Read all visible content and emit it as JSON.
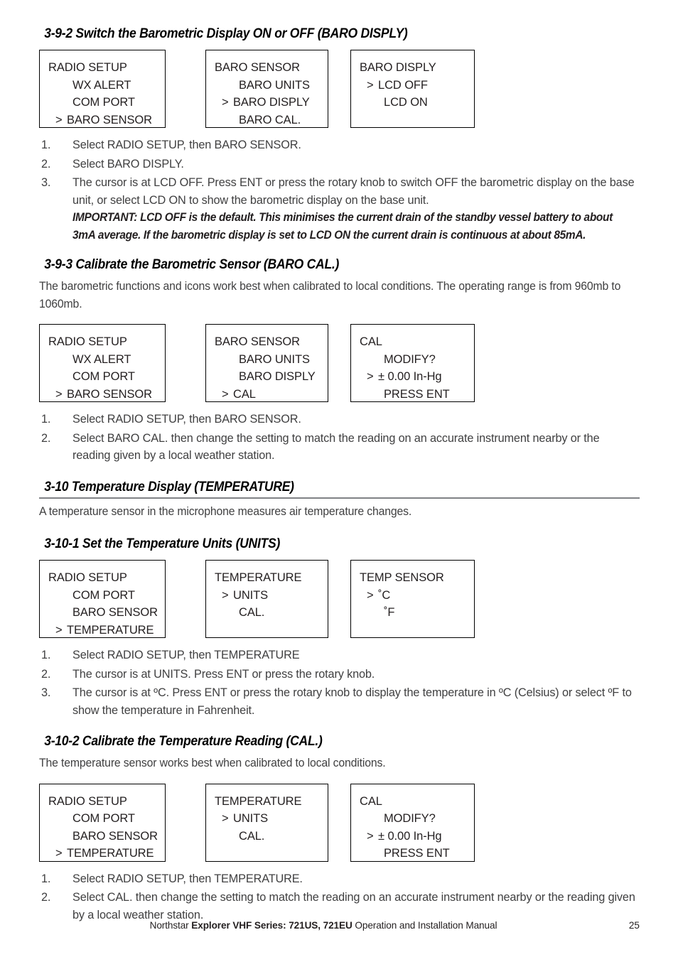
{
  "document": {
    "footer": {
      "prefix": "Northstar ",
      "brand": "Explorer VHF Series: 721US, 721EU",
      "suffix": " Operation and Installation Manual",
      "page_number": "25"
    }
  },
  "sections": {
    "s392": {
      "heading": "3-9-2 Switch the Barometric Display ON or OFF (BARO DISPLY)",
      "boxes": {
        "box1": {
          "title": "RADIO SETUP",
          "items": [
            "WX ALERT",
            "COM PORT"
          ],
          "selected": "BARO SENSOR",
          "cursor": ">"
        },
        "box2": {
          "title": "BARO SENSOR",
          "items_before": [
            "BARO UNITS"
          ],
          "selected": "BARO DISPLY",
          "items_after": [
            "BARO CAL."
          ],
          "cursor": ">"
        },
        "box3": {
          "title": "BARO DISPLY",
          "selected": "LCD OFF",
          "items_after": [
            "LCD ON"
          ],
          "cursor": ">"
        }
      },
      "steps": [
        {
          "num": "1.",
          "text": "Select RADIO SETUP, then BARO SENSOR."
        },
        {
          "num": "2.",
          "text": "Select BARO DISPLY."
        },
        {
          "num": "3.",
          "text": "The cursor is at LCD OFF. Press ENT or press the rotary knob to switch OFF the barometric display on the base unit, or select LCD ON to show the barometric display on the base unit.",
          "note": "IMPORTANT: LCD OFF is the default. This minimises the current drain of the standby vessel battery to about 3mA average. If the barometric display is set to LCD ON the current drain is continuous at about 85mA."
        }
      ]
    },
    "s393": {
      "heading": "3-9-3 Calibrate the Barometric Sensor (BARO CAL.)",
      "intro": "The barometric functions and icons work best when calibrated to local conditions. The operating range is from 960mb to 1060mb.",
      "boxes": {
        "box1": {
          "title": "RADIO SETUP",
          "items": [
            "WX ALERT",
            "COM PORT"
          ],
          "selected": "BARO SENSOR",
          "cursor": ">"
        },
        "box2": {
          "title": "BARO SENSOR",
          "items": [
            "BARO UNITS",
            "BARO DISPLY"
          ],
          "selected": "CAL",
          "cursor": ">"
        },
        "box3": {
          "title": "CAL",
          "items": [
            "MODIFY?"
          ],
          "selected": "± 0.00 In-Hg",
          "items_after": [
            "PRESS ENT"
          ],
          "cursor": ">"
        }
      },
      "steps": [
        {
          "num": "1.",
          "text": "Select RADIO SETUP, then BARO SENSOR."
        },
        {
          "num": "2.",
          "text": "Select BARO CAL. then change the setting to match the reading on an accurate instrument nearby or the reading given by a local weather station."
        }
      ]
    },
    "s310": {
      "heading": "3-10 Temperature Display (TEMPERATURE)",
      "intro": "A temperature sensor in the microphone measures air temperature changes."
    },
    "s3101": {
      "heading": "3-10-1 Set the Temperature Units (UNITS)",
      "boxes": {
        "box1": {
          "title": "RADIO SETUP",
          "items": [
            "COM PORT",
            "BARO SENSOR"
          ],
          "selected": "TEMPERATURE",
          "cursor": ">"
        },
        "box2": {
          "title": "TEMPERATURE",
          "selected": "UNITS",
          "items_after": [
            "CAL."
          ],
          "cursor": ">"
        },
        "box3": {
          "title": "TEMP SENSOR",
          "selected": "˚C",
          "items_after": [
            "˚F"
          ],
          "cursor": ">"
        }
      },
      "steps": [
        {
          "num": "1.",
          "text": "Select RADIO SETUP, then TEMPERATURE"
        },
        {
          "num": "2.",
          "text": "The cursor is at UNITS. Press ENT or press the rotary knob."
        },
        {
          "num": "3.",
          "text": "The cursor is at ºC. Press ENT or press the rotary knob to display the temperature in ºC (Celsius) or select ºF to show the temperature in Fahrenheit."
        }
      ]
    },
    "s3102": {
      "heading": "3-10-2 Calibrate the Temperature Reading (CAL.)",
      "intro": "The temperature sensor works best when calibrated to local conditions.",
      "boxes": {
        "box1": {
          "title": "RADIO SETUP",
          "items": [
            "COM PORT",
            "BARO SENSOR"
          ],
          "selected": "TEMPERATURE",
          "cursor": ">"
        },
        "box2": {
          "title": "TEMPERATURE",
          "selected": "UNITS",
          "items_after": [
            "CAL."
          ],
          "cursor": ">"
        },
        "box3": {
          "title": "CAL",
          "items": [
            "MODIFY?"
          ],
          "selected": "± 0.00 In-Hg",
          "items_after": [
            "PRESS ENT"
          ],
          "cursor": ">"
        }
      },
      "steps": [
        {
          "num": "1.",
          "text": "Select RADIO SETUP, then TEMPERATURE."
        },
        {
          "num": "2.",
          "text": "Select CAL. then change the setting to match the reading on an accurate instrument nearby or the reading given by a local weather station."
        }
      ]
    }
  }
}
